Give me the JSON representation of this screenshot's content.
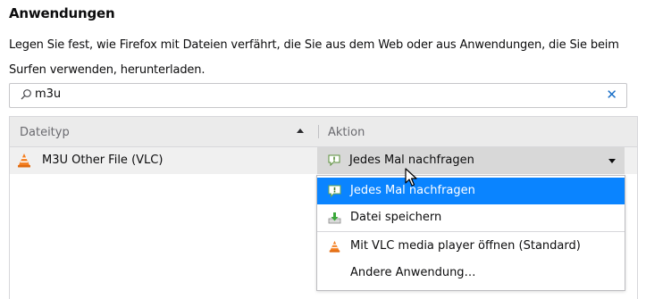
{
  "section": {
    "title": "Anwendungen",
    "description": "Legen Sie fest, wie Firefox mit Dateien verfährt, die Sie aus dem Web oder aus Anwendungen, die Sie beim Surfen verwenden, herunterladen."
  },
  "search": {
    "value": "m3u",
    "clear_icon": "close-icon"
  },
  "table": {
    "columns": [
      "Dateityp",
      "Aktion"
    ],
    "sort_column": "Dateityp",
    "sort_direction": "ascending",
    "rows": [
      {
        "type": "M3U Other File (VLC)",
        "icon": "vlc-icon",
        "action": "Jedes Mal nachfragen",
        "action_icon": "ask-icon"
      }
    ]
  },
  "dropdown": {
    "open": true,
    "selected_index": 0,
    "options": [
      {
        "label": "Jedes Mal nachfragen",
        "icon": "ask-icon"
      },
      {
        "label": "Datei speichern",
        "icon": "save-download-icon"
      },
      {
        "label": "Mit VLC media player öffnen (Standard)",
        "icon": "vlc-icon"
      },
      {
        "label": "Andere Anwendung…",
        "icon": ""
      }
    ]
  },
  "colors": {
    "accent": "#0a84ff",
    "header_bg": "#ebebeb",
    "row_bg": "#f0f0f0",
    "clear_icon": "#1a6fc7",
    "vlc_orange": "#f47e1f"
  }
}
